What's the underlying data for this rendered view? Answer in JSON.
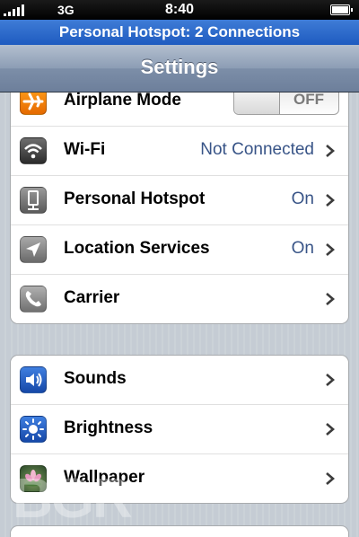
{
  "status_bar": {
    "network": "3G",
    "time": "8:40"
  },
  "hotspot_banner": "Personal Hotspot: 2 Connections",
  "nav": {
    "title": "Settings"
  },
  "group1": [
    {
      "label": "Airplane Mode",
      "toggle": "OFF",
      "icon": "airplane-icon"
    },
    {
      "label": "Wi-Fi",
      "value": "Not Connected",
      "icon": "wifi-icon"
    },
    {
      "label": "Personal Hotspot",
      "value": "On",
      "icon": "hotspot-icon"
    },
    {
      "label": "Location Services",
      "value": "On",
      "icon": "location-arrow-icon"
    },
    {
      "label": "Carrier",
      "value": "",
      "icon": "phone-icon"
    }
  ],
  "group2": [
    {
      "label": "Sounds",
      "icon": "speaker-icon"
    },
    {
      "label": "Brightness",
      "icon": "sun-icon"
    },
    {
      "label": "Wallpaper",
      "icon": "flower-icon"
    }
  ],
  "watermark": "BGR",
  "colors": {
    "banner": "#2a67cc",
    "value_text": "#385487",
    "nav": "#7c8ea8"
  }
}
